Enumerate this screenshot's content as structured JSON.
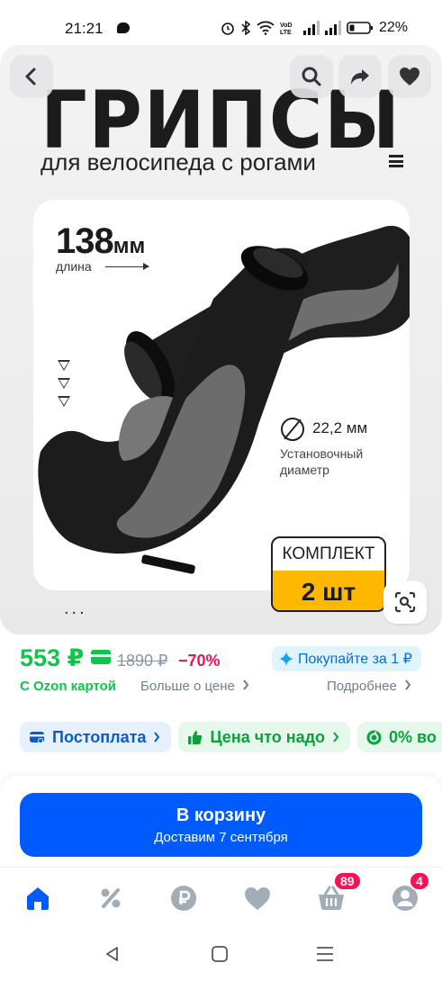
{
  "status_bar": {
    "time": "21:21",
    "battery": "22%"
  },
  "hero": {
    "title": "ГРИПСЫ",
    "subtitle": "для велосипеда с рогами",
    "length_value": "138",
    "length_unit": "мм",
    "length_label": "длина",
    "diameter_value": "22,2 мм",
    "diameter_label": "Установочный диаметр",
    "kit_label": "КОМПЛЕКТ",
    "kit_count": "2 шт",
    "dots": "..."
  },
  "price": {
    "current": "553 ₽",
    "old": "1890 ₽",
    "discount": "−70%",
    "buy_for": "Покупайте за 1 ₽",
    "ozon_card": "С Ozon картой",
    "more_about_price": "Больше о цене",
    "more_detail": "Подробнее"
  },
  "chips": [
    {
      "label": "Постоплата"
    },
    {
      "label": "Цена что надо"
    },
    {
      "label": "0% во"
    }
  ],
  "cart": {
    "title": "В корзину",
    "subtitle": "Доставим 7 сентября"
  },
  "nav": {
    "cart_badge": "89",
    "profile_badge": "4"
  },
  "colors": {
    "price_green": "#10c44c",
    "primary_blue": "#005bff",
    "discount_pink": "#f91155",
    "kit_yellow": "#ffb800"
  }
}
